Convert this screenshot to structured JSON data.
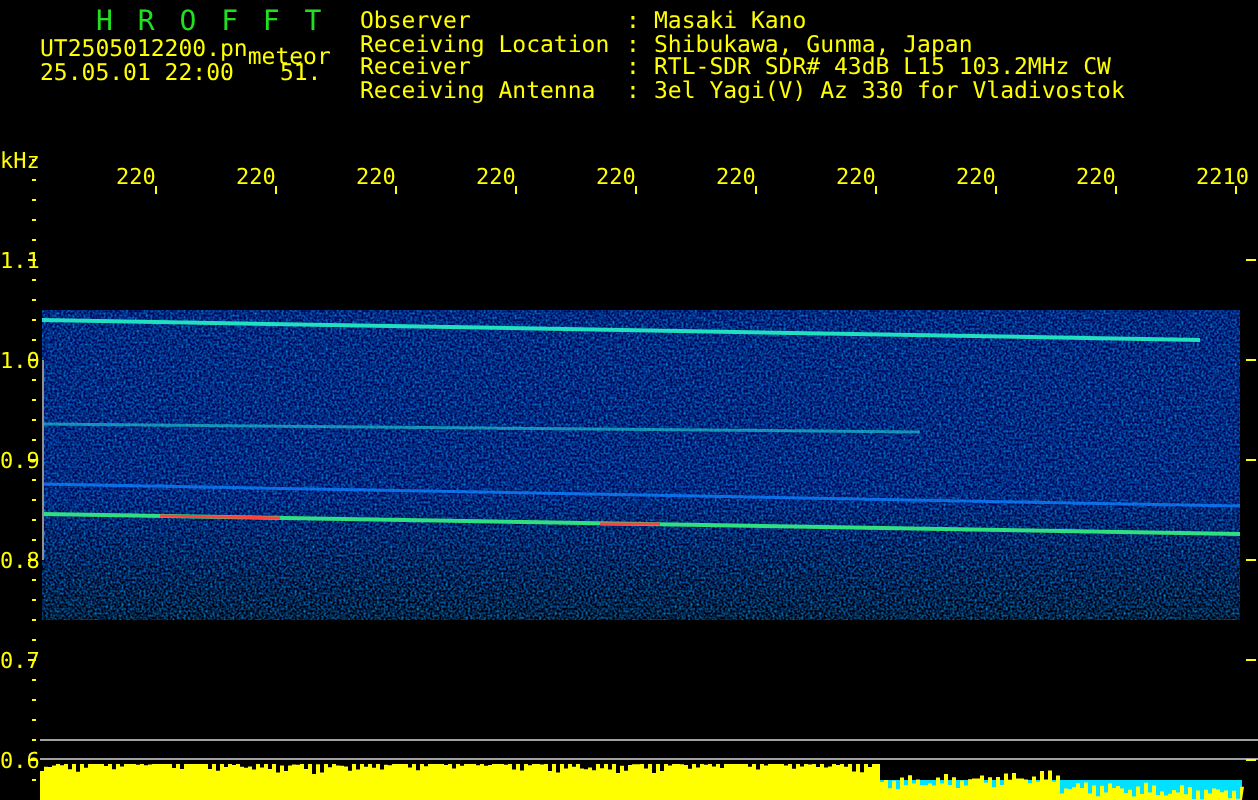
{
  "header": {
    "title": "H R O F F T",
    "file_name": "UT2505012200.pn",
    "type_label": "meteor",
    "timestamp": "25.05.01 22:00",
    "count": "51."
  },
  "station_info": [
    {
      "label": "Observer",
      "separator": ":",
      "value": "Masaki Kano"
    },
    {
      "label": "Receiving Location",
      "separator": ":",
      "value": "Shibukawa, Gunma, Japan"
    },
    {
      "label": "Receiver",
      "separator": ":",
      "value": "RTL-SDR SDR# 43dB L15 103.2MHz CW"
    },
    {
      "label": "Receiving Antenna",
      "separator": ":",
      "value": "3el Yagi(V) Az 330 for Vladivostok"
    }
  ],
  "spectrogram": {
    "unit_label": "kHz",
    "x_labels": [
      "220",
      "220",
      "220",
      "220",
      "220",
      "220",
      "220",
      "220",
      "220",
      "2210"
    ],
    "y_labels": [
      "1.1",
      "1.0",
      "0.9",
      "0.8",
      "0.7",
      "0.6"
    ]
  }
}
